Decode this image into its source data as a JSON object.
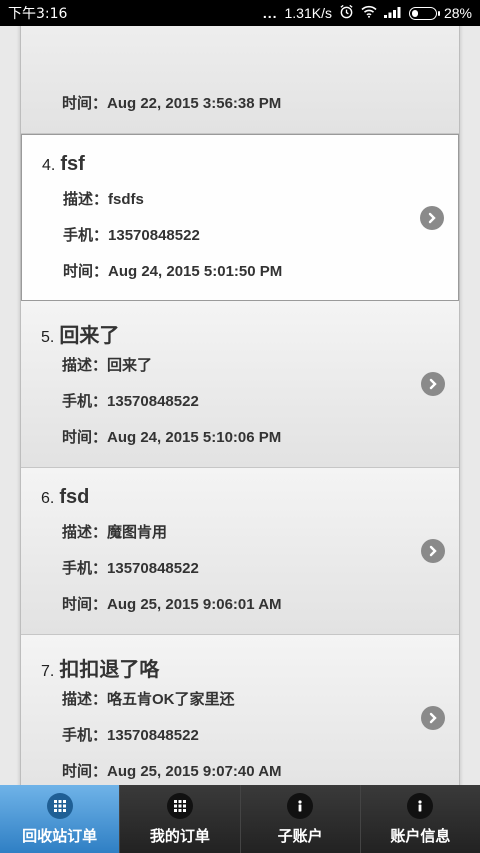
{
  "status_bar": {
    "time": "下午3:16",
    "signal_dots": "...",
    "speed": "1.31K/s",
    "battery": "28%",
    "battery_level": 0.28
  },
  "partial_item": {
    "time_label": "时间：",
    "time_value": "Aug 22, 2015 3:56:38 PM"
  },
  "orders": [
    {
      "num": "4.",
      "title": "fsf",
      "desc_label": "描述：",
      "desc": "fsdfs",
      "phone_label": "手机：",
      "phone": "13570848522",
      "time_label": "时间：",
      "time": "Aug 24, 2015 5:01:50 PM"
    },
    {
      "num": "5.",
      "title": "回来了",
      "desc_label": "描述：",
      "desc": "回来了",
      "phone_label": "手机：",
      "phone": "13570848522",
      "time_label": "时间：",
      "time": "Aug 24, 2015 5:10:06 PM"
    },
    {
      "num": "6.",
      "title": "fsd",
      "desc_label": "描述：",
      "desc": "魔图肯用",
      "phone_label": "手机：",
      "phone": "13570848522",
      "time_label": "时间：",
      "time": "Aug 25, 2015 9:06:01 AM"
    },
    {
      "num": "7.",
      "title": "扣扣退了咯",
      "desc_label": "描述：",
      "desc": "咯五肯OK了家里还",
      "phone_label": "手机：",
      "phone": "13570848522",
      "time_label": "时间：",
      "time": "Aug 25, 2015 9:07:40 AM"
    }
  ],
  "tabs": [
    {
      "label": "回收站订单",
      "icon": "grid-icon"
    },
    {
      "label": "我的订单",
      "icon": "grid-icon"
    },
    {
      "label": "子账户",
      "icon": "info-icon"
    },
    {
      "label": "账户信息",
      "icon": "info-icon"
    }
  ],
  "colors": {
    "active_tab": "#3a8fd4",
    "tab_bg": "#2a2a2a"
  }
}
